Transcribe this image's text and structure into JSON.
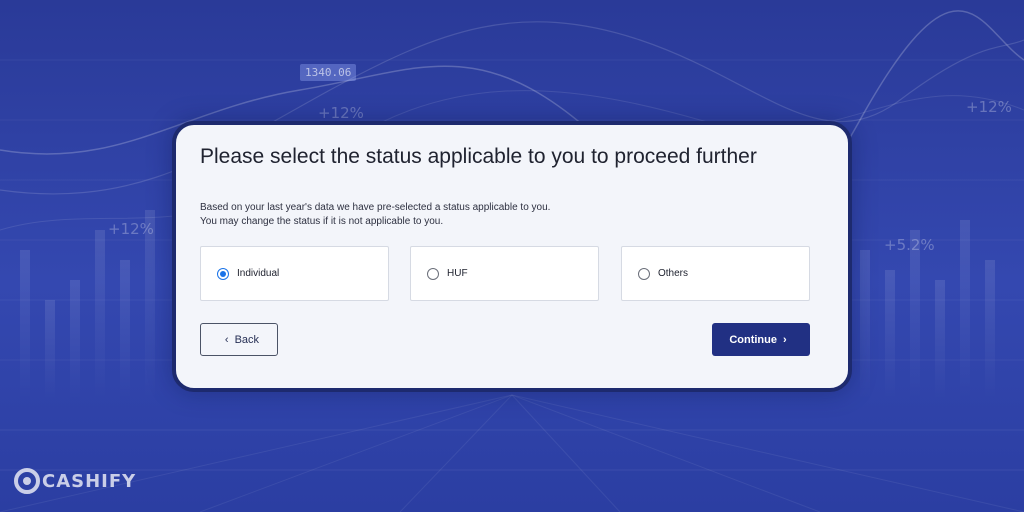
{
  "background": {
    "tags": [
      "1340.06",
      "+12%",
      "+12%",
      "+5.2%",
      "+12%"
    ]
  },
  "dialog": {
    "title": "Please select the status applicable to you to proceed further",
    "subtitle_line1": "Based on your last year's data we have pre-selected a status applicable to you.",
    "subtitle_line2": "You may change the status if it is not applicable to you.",
    "options": [
      {
        "label": "Individual",
        "selected": true
      },
      {
        "label": "HUF",
        "selected": false
      },
      {
        "label": "Others",
        "selected": false
      }
    ],
    "back_label": "Back",
    "continue_label": "Continue",
    "back_icon": "chevron-left-icon",
    "continue_icon": "chevron-right-icon"
  },
  "brand": {
    "name": "CASHIFY",
    "icon": "cashify-logo-icon"
  },
  "colors": {
    "background": "#2b3f9e",
    "card": "#f3f5fa",
    "primary_button": "#213083",
    "radio_selected": "#1a73e8"
  }
}
